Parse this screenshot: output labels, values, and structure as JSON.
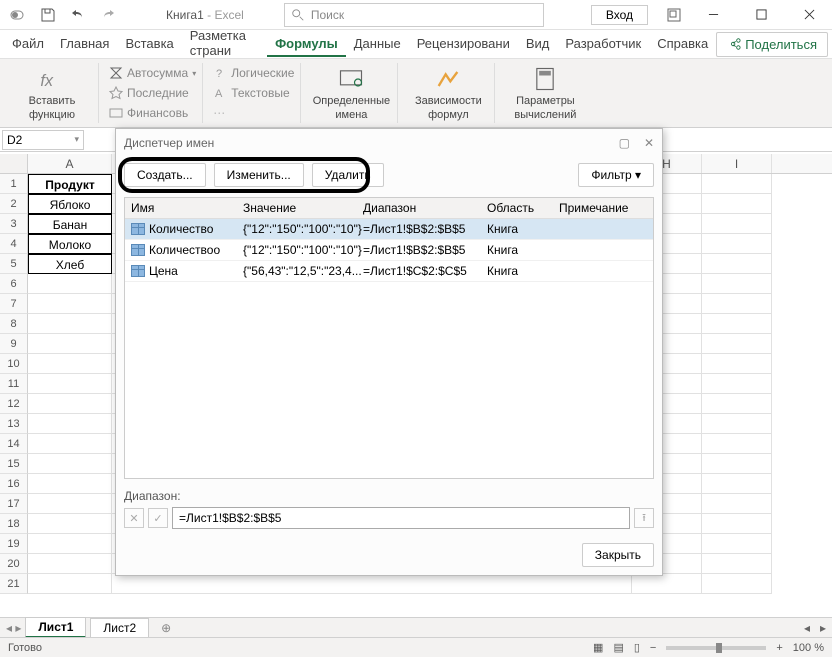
{
  "titlebar": {
    "doc_name": "Книга1",
    "app_name": "Excel",
    "search_placeholder": "Поиск",
    "login": "Вход"
  },
  "tabs": {
    "file": "Файл",
    "home": "Главная",
    "insert": "Вставка",
    "layout": "Разметка страни",
    "formulas": "Формулы",
    "data": "Данные",
    "review": "Рецензировани",
    "view": "Вид",
    "developer": "Разработчик",
    "help": "Справка",
    "share": "Поделиться"
  },
  "ribbon": {
    "insert_fn1": "Вставить",
    "insert_fn2": "функцию",
    "autosum": "Автосумма",
    "recent": "Последние",
    "financial": "Финансовь",
    "logical": "Логические",
    "text": "Текстовые",
    "defined1": "Определенные",
    "defined2": "имена",
    "depend1": "Зависимости",
    "depend2": "формул",
    "params1": "Параметры",
    "params2": "вычислений"
  },
  "namebox": "D2",
  "sheet": {
    "cols": [
      "A",
      "",
      "",
      "",
      "",
      "",
      "H",
      "I"
    ],
    "a1": "Продукт",
    "a2": "Яблоко",
    "a3": "Банан",
    "a4": "Молоко",
    "a5": "Хлеб"
  },
  "dialog": {
    "title": "Диспетчер имен",
    "create": "Создать...",
    "edit": "Изменить...",
    "delete": "Удалить",
    "filter": "Фильтр",
    "head": {
      "name": "Имя",
      "value": "Значение",
      "range": "Диапазон",
      "scope": "Область",
      "note": "Примечание"
    },
    "rows": [
      {
        "name": "Количество",
        "value": "{\"12\":\"150\":\"100\":\"10\"}",
        "range": "=Лист1!$B$2:$B$5",
        "scope": "Книга"
      },
      {
        "name": "Количествоо",
        "value": "{\"12\":\"150\":\"100\":\"10\"}",
        "range": "=Лист1!$B$2:$B$5",
        "scope": "Книга"
      },
      {
        "name": "Цена",
        "value": "{\"56,43\":\"12,5\":\"23,4...",
        "range": "=Лист1!$C$2:$C$5",
        "scope": "Книга"
      }
    ],
    "range_label": "Диапазон:",
    "range_value": "=Лист1!$B$2:$B$5",
    "close": "Закрыть"
  },
  "sheets": {
    "s1": "Лист1",
    "s2": "Лист2"
  },
  "status": {
    "ready": "Готово",
    "zoom": "100 %"
  }
}
